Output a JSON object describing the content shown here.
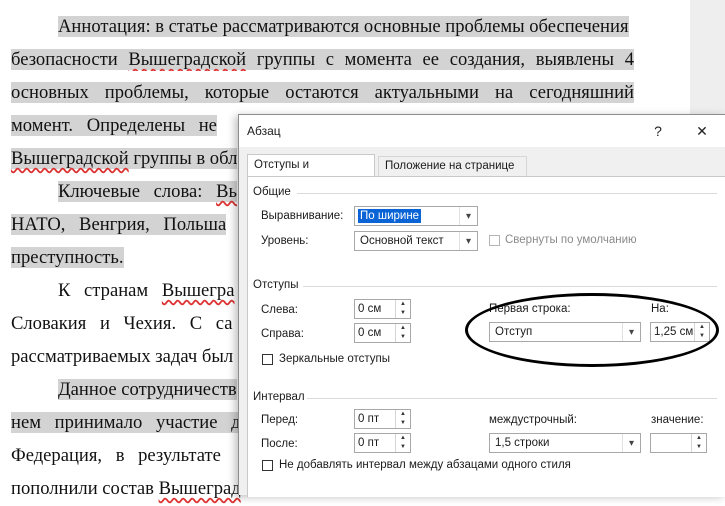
{
  "document": {
    "lines": [
      {
        "id": "l1",
        "parts": [
          {
            "text": "Аннотация: в статье рассматриваются основные проблемы обеспечения",
            "hl": true
          }
        ]
      },
      {
        "id": "l2",
        "parts": [
          {
            "text": "безопасности ",
            "hl": true
          },
          {
            "text": "Вышеградской",
            "hl": true,
            "sq": true
          },
          {
            "text": " группы с момента ее создания, выявлены 4",
            "hl": true
          }
        ]
      },
      {
        "id": "l3",
        "parts": [
          {
            "text": "основных проблемы, которые остаются актуальными на сегодняшний",
            "hl": true
          }
        ]
      },
      {
        "id": "l4",
        "parts": [
          {
            "text": "момент. Определены не",
            "hl": true
          }
        ]
      },
      {
        "id": "l5",
        "parts": [
          {
            "text": "Вышеградской",
            "hl": true,
            "sq": true
          },
          {
            "text": " группы в обл",
            "hl": true
          }
        ]
      },
      {
        "id": "l6",
        "parts": [
          {
            "text": "Ключевые слова: ",
            "hl": true
          },
          {
            "text": "Вь",
            "hl": true,
            "sq": true
          }
        ]
      },
      {
        "id": "l7",
        "parts": [
          {
            "text": "НАТО, Венгрия, Польша",
            "hl": true
          }
        ]
      },
      {
        "id": "l8",
        "parts": [
          {
            "text": "преступность.",
            "hl": true
          }
        ]
      },
      {
        "id": "l9",
        "parts": [
          {
            "text": "К странам ",
            "hl": false
          },
          {
            "text": "Вышегра",
            "hl": false,
            "sq": true
          }
        ]
      },
      {
        "id": "l10",
        "parts": [
          {
            "text": "Словакия и Чехия. С са",
            "hl": false
          }
        ]
      },
      {
        "id": "l11",
        "parts": [
          {
            "text": "рассматриваемых задач был",
            "hl": false
          }
        ]
      },
      {
        "id": "l12",
        "parts": [
          {
            "text": "Данное сотрудничеств",
            "hl": true
          }
        ]
      },
      {
        "id": "l13",
        "parts": [
          {
            "text": "нем принимало участие дв",
            "hl": true
          }
        ]
      },
      {
        "id": "l14",
        "parts": [
          {
            "text": "Федерация, в результате",
            "hl": false
          }
        ]
      },
      {
        "id": "l15",
        "parts": [
          {
            "text": "пополнили состав ",
            "hl": false
          },
          {
            "text": "Вышеград",
            "hl": false,
            "sq": true
          }
        ]
      }
    ]
  },
  "dialog": {
    "title": "Абзац",
    "help_label": "?",
    "close_label": "✕",
    "tabs": [
      {
        "label": "Отступы и интервалы",
        "active": true
      },
      {
        "label": "Положение на странице",
        "active": false
      }
    ],
    "general": {
      "heading": "Общие",
      "alignment_label": "Выравнивание:",
      "alignment_value": "По ширине",
      "level_label": "Уровень:",
      "level_value": "Основной текст",
      "collapsed_label": "Свернуты по умолчанию"
    },
    "indents": {
      "heading": "Отступы",
      "left_label": "Слева:",
      "left_value": "0 см",
      "right_label": "Справа:",
      "right_value": "0 см",
      "mirror_label": "Зеркальные отступы",
      "first_line_label": "Первая строка:",
      "first_line_value": "Отступ",
      "by_label": "На:",
      "by_value": "1,25 см"
    },
    "spacing": {
      "heading": "Интервал",
      "before_label": "Перед:",
      "before_value": "0 пт",
      "after_label": "После:",
      "after_value": "0 пт",
      "line_spacing_label": "междустрочный:",
      "line_spacing_value": "1,5 строки",
      "at_label": "значение:",
      "at_value": "",
      "no_space_label": "Не добавлять интервал между абзацами одного стиля"
    }
  },
  "colors": {
    "highlight": "#d3d3d3",
    "selection": "#0a64d6",
    "annotation_ellipse": "#000000"
  }
}
